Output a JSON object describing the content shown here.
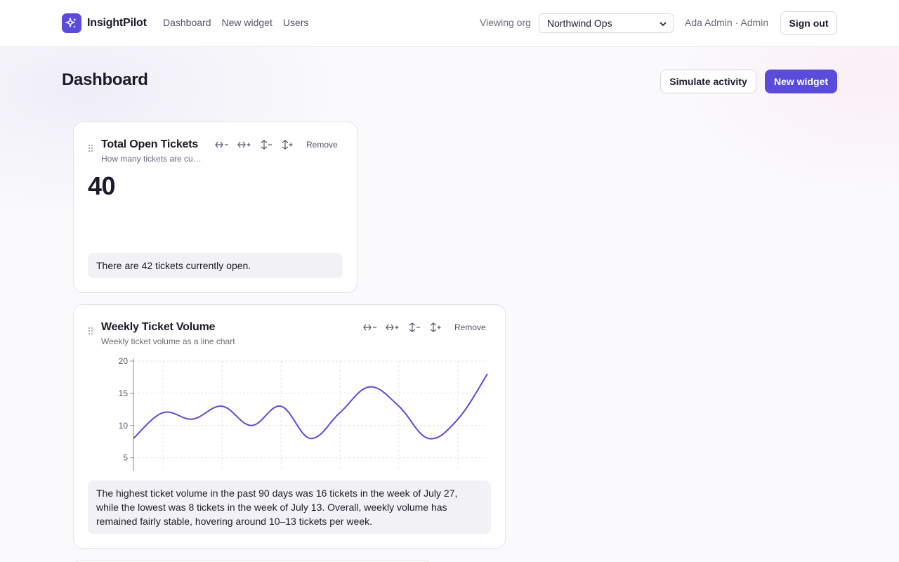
{
  "app": {
    "brand_name": "InsightPilot",
    "brand_icon": "sparkles-icon",
    "accent_color": "#5b4bdb"
  },
  "nav": {
    "items": [
      {
        "label": "Dashboard"
      },
      {
        "label": "New widget"
      },
      {
        "label": "Users"
      }
    ]
  },
  "header": {
    "viewing_label": "Viewing org",
    "org_selected": "Northwind Ops",
    "user_label": "Ada Admin · Admin",
    "signout_label": "Sign out"
  },
  "page": {
    "title": "Dashboard",
    "simulate_label": "Simulate activity",
    "new_widget_label": "New widget"
  },
  "widget_tools": {
    "remove_label": "Remove",
    "tool_icons": [
      "shrink-width-icon",
      "grow-width-icon",
      "shrink-height-icon",
      "grow-height-icon"
    ]
  },
  "widgets": [
    {
      "title": "Total Open Tickets",
      "subtitle": "How many tickets are cu…",
      "value": "40",
      "summary": "There are 42 tickets currently open."
    },
    {
      "title": "Weekly Ticket Volume",
      "subtitle": "Weekly ticket volume as a line chart",
      "summary": "The highest ticket volume in the past 90 days was 16 tickets in the week of July 27, while the lowest was 8 tickets in the week of July 13. Overall, weekly volume has remained fairly stable, hovering around 10–13 tickets per week."
    }
  ],
  "chart_data": {
    "type": "line",
    "title": "",
    "xlabel": "",
    "ylabel": "",
    "x": [
      0,
      1,
      2,
      3,
      4,
      5,
      6,
      7,
      8,
      9,
      10,
      11,
      12
    ],
    "values": [
      8,
      12,
      11,
      13,
      10,
      13,
      8,
      12,
      16,
      13,
      8,
      11,
      18
    ],
    "yticks": [
      5,
      10,
      15,
      20
    ],
    "ylim": [
      3,
      20
    ],
    "grid": true,
    "legend": "none",
    "color": "#5b4bdb"
  }
}
